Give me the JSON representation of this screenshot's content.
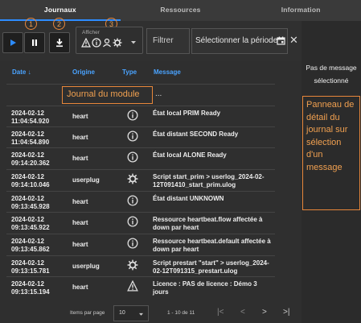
{
  "tabs": [
    {
      "label": "Journaux",
      "active": true
    },
    {
      "label": "Ressources",
      "active": false
    },
    {
      "label": "Information",
      "active": false
    }
  ],
  "toolbar": {
    "markers": [
      "1",
      "2",
      "3"
    ],
    "afficher_label": "Afficher",
    "filter_placeholder": "Filtrer",
    "period_placeholder": "Sélectionner la période"
  },
  "table": {
    "headers": {
      "date": "Date",
      "origin": "Origine",
      "type": "Type",
      "message": "Message"
    },
    "rows": [
      {
        "date": "2024-02-12",
        "time": "11:04:54.920",
        "origin": "heart",
        "type": "info-icon",
        "message": "État local PRIM Ready"
      },
      {
        "date": "2024-02-12",
        "time": "11:04:54.890",
        "origin": "heart",
        "type": "info-icon",
        "message": "État distant SECOND Ready"
      },
      {
        "date": "2024-02-12",
        "time": "09:14:20.362",
        "origin": "heart",
        "type": "info-icon",
        "message": "État local ALONE Ready"
      },
      {
        "date": "2024-02-12",
        "time": "09:14:10.046",
        "origin": "userplug",
        "type": "gear-icon",
        "message": "Script start_prim > userlog_2024-02-12T091410_start_prim.ulog"
      },
      {
        "date": "2024-02-12",
        "time": "09:13:45.928",
        "origin": "heart",
        "type": "info-icon",
        "message": "État distant UNKNOWN"
      },
      {
        "date": "2024-02-12",
        "time": "09:13:45.922",
        "origin": "heart",
        "type": "info-icon",
        "message": "Ressource heartbeat.flow affectée à down par heart"
      },
      {
        "date": "2024-02-12",
        "time": "09:13:45.862",
        "origin": "heart",
        "type": "info-icon",
        "message": "Ressource heartbeat.default affectée à down par heart"
      },
      {
        "date": "2024-02-12",
        "time": "09:13:15.781",
        "origin": "userplug",
        "type": "gear-icon",
        "message": "Script prestart \"start\" > userlog_2024-02-12T091315_prestart.ulog"
      },
      {
        "date": "2024-02-12",
        "time": "09:13:15.194",
        "origin": "heart",
        "type": "warning-icon",
        "message": "Licence : PAS de licence : Démo 3 jours"
      }
    ]
  },
  "annotation_journal": "Journal du module",
  "annotation_ellipsis": "...",
  "pager": {
    "items_per_page_label": "Items par page",
    "items_per_page_value": "10",
    "range": "1 - 10 de 11"
  },
  "side": {
    "no_message_line1": "Pas de message",
    "no_message_line2": "sélectionné",
    "panel_label": "Panneau de détail du journal sur sélection d'un message"
  },
  "colors": {
    "accent": "#2d8cff",
    "annotation": "#e8873a",
    "header_text": "#4aa3ff"
  }
}
